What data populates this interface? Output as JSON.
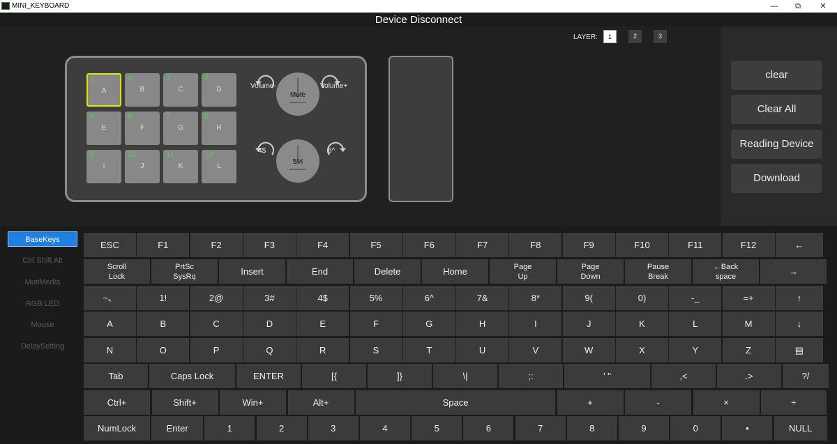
{
  "window": {
    "title": "MINI_KEYBOARD",
    "min": "—",
    "restore": "⧉",
    "close": "✕"
  },
  "status": "Device Disconnect",
  "layers": {
    "label": "LAYER:",
    "items": [
      "1",
      "2",
      "3"
    ],
    "active": "1"
  },
  "device": {
    "keys": [
      {
        "num": "1",
        "label": "A"
      },
      {
        "num": "2",
        "label": "B"
      },
      {
        "num": "3",
        "label": "C"
      },
      {
        "num": "4",
        "label": "D"
      },
      {
        "num": "5",
        "label": "E"
      },
      {
        "num": "6",
        "label": "F"
      },
      {
        "num": "7",
        "label": "G"
      },
      {
        "num": "8",
        "label": "H"
      },
      {
        "num": "9",
        "label": "I"
      },
      {
        "num": "10",
        "label": "J"
      },
      {
        "num": "11",
        "label": "K"
      },
      {
        "num": "12",
        "label": "L"
      }
    ],
    "knob1": {
      "left": "Volume-",
      "right": "Volume+",
      "center": "Mute"
    },
    "knob2": {
      "left": "4$",
      "right": "6^",
      "center": "5%"
    }
  },
  "actions": [
    "clear",
    "Clear All",
    "Reading Device",
    "Download"
  ],
  "sidebar": [
    "BaseKeys",
    "Ctrl Shift Alt",
    "MutiMedia",
    "RGB LED",
    "Mouse",
    "DelaySetting"
  ],
  "keyboard": {
    "row1": [
      "ESC",
      "F1",
      "F2",
      "F3",
      "F4",
      "F5",
      "F6",
      "F7",
      "F8",
      "F9",
      "F10",
      "F11",
      "F12",
      "←"
    ],
    "row2": [
      "Scroll\nLock",
      "PrtSc\nSysRq",
      "Insert",
      "End",
      "Delete",
      "Home",
      "Page\nUp",
      "Page\nDown",
      "Pause\nBreak",
      "←Back\nspace",
      "→"
    ],
    "row3": [
      "~、",
      "1!",
      "2@",
      "3#",
      "4$",
      "5%",
      "6^",
      "7&",
      "8*",
      "9(",
      "0)",
      "-_",
      "=+",
      "↑"
    ],
    "row4": [
      "A",
      "B",
      "C",
      "D",
      "E",
      "F",
      "G",
      "H",
      "I",
      "J",
      "K",
      "L",
      "M",
      "↓"
    ],
    "row5": [
      "N",
      "O",
      "P",
      "Q",
      "R",
      "S",
      "T",
      "U",
      "V",
      "W",
      "X",
      "Y",
      "Z",
      "▤"
    ],
    "row6": [
      "Tab",
      "Caps Lock",
      "ENTER",
      "[{",
      "]}",
      "\\|",
      ";:",
      "' \"",
      ",<",
      ".>",
      "?/"
    ],
    "row7": [
      "Ctrl+",
      "Shift+",
      "Win+",
      "Alt+",
      "Space",
      "+",
      "-",
      "×",
      "÷"
    ],
    "row8": [
      "NumLock",
      "Enter",
      "1",
      "2",
      "3",
      "4",
      "5",
      "6",
      "7",
      "8",
      "9",
      "0",
      "•",
      "NULL"
    ]
  },
  "colors": {
    "accent": "#1f7fe3",
    "keynum": "#4ecf4e",
    "selected": "#e3e300"
  }
}
